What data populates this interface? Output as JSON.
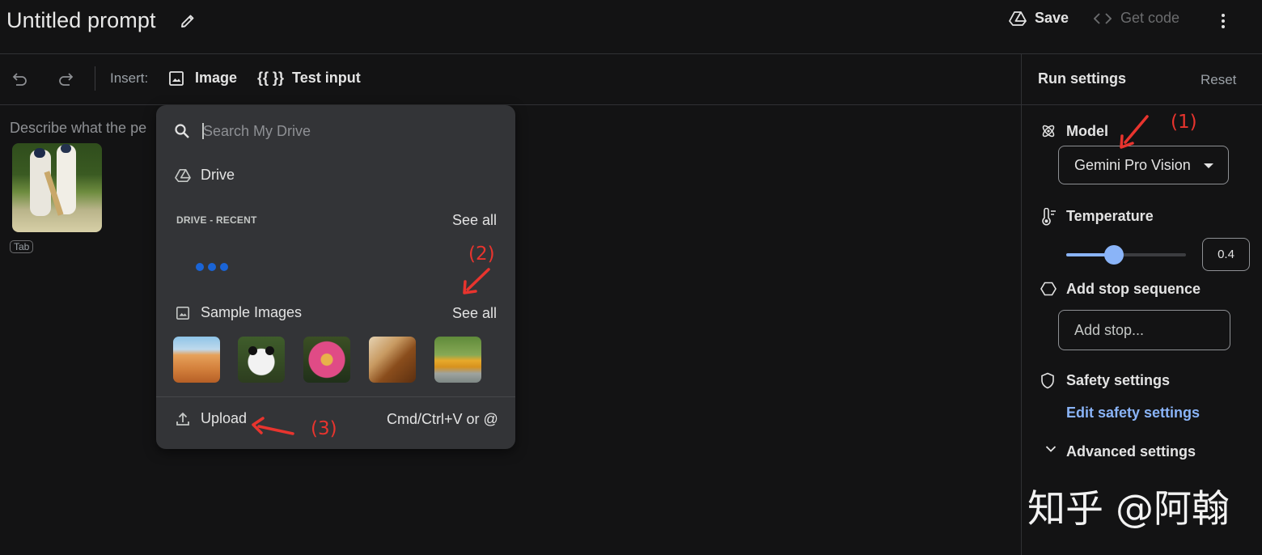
{
  "header": {
    "title": "Untitled prompt",
    "save_label": "Save",
    "get_code_label": "Get code"
  },
  "toolbar": {
    "insert_label": "Insert:",
    "image_label": "Image",
    "test_input_icon": "{{ }}",
    "test_input_label": "Test input"
  },
  "editor": {
    "placeholder": "Describe what the pe",
    "tab_chip": "Tab"
  },
  "insert_menu": {
    "search_placeholder": "Search My Drive",
    "drive_label": "Drive",
    "recent_header": "DRIVE - RECENT",
    "see_all_recent": "See all",
    "sample_images_label": "Sample Images",
    "see_all_samples": "See all",
    "sample_images": [
      "desert",
      "panda",
      "flower",
      "violin",
      "school-bus"
    ],
    "upload_label": "Upload",
    "upload_shortcut": "Cmd/Ctrl+V or @"
  },
  "run_settings": {
    "title": "Run settings",
    "reset_label": "Reset",
    "model_label": "Model",
    "model_value": "Gemini Pro Vision",
    "temperature_label": "Temperature",
    "temperature_value": "0.4",
    "temperature_fraction": 0.4,
    "stop_sequence_label": "Add stop sequence",
    "stop_placeholder": "Add stop...",
    "safety_label": "Safety settings",
    "edit_safety_label": "Edit safety settings",
    "advanced_label": "Advanced settings"
  },
  "annotations": {
    "label_1": "(1)",
    "label_2": "(2)",
    "label_3": "(3)",
    "color": "#e8342e"
  },
  "watermark": "知乎 @阿翰",
  "colors": {
    "background": "#131314",
    "menu_background": "#333437",
    "accent": "#8ab4f8",
    "loading_dot": "#1a64d6"
  }
}
